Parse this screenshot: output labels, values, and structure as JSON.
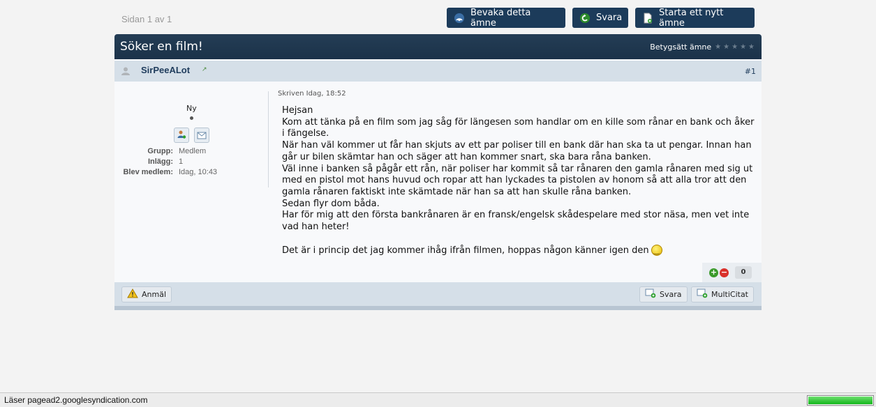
{
  "pager": {
    "text": "Sidan 1 av 1"
  },
  "top_buttons": {
    "watch": "Bevaka detta ämne",
    "reply": "Svara",
    "new_topic": "Starta ett nytt ämne"
  },
  "topic": {
    "title": "Söker en film!",
    "rate_label": "Betygsätt ämne",
    "stars": [
      "★",
      "★",
      "★",
      "★",
      "★"
    ]
  },
  "post": {
    "author": "SirPeeALot",
    "number": "#1",
    "rank": "Ny",
    "info": {
      "group_label": "Grupp:",
      "group_value": "Medlem",
      "posts_label": "Inlägg:",
      "posts_value": "1",
      "joined_label": "Blev medlem:",
      "joined_value": "Idag, 10:43"
    },
    "posted": "Skriven Idag, 18:52",
    "body_lines": [
      "Hejsan",
      "Kom att tänka på en film som jag såg för längesen som handlar om en kille som rånar en bank och åker i fängelse.",
      "När han väl kommer ut får han skjuts av ett par poliser till en bank där han ska ta ut pengar. Innan han går ur bilen skämtar han och säger att han kommer snart, ska bara råna banken.",
      "Väl inne i banken så pågår ett rån, när poliser har kommit så tar rånaren den gamla rånaren med sig ut med en pistol mot hans huvud och ropar att han lyckades ta pistolen av honom så att alla tror att den gamla rånaren faktiskt inte skämtade när han sa att han skulle råna banken.",
      "Sedan flyr dom båda.",
      "Har för mig att den första bankrånaren är en fransk/engelsk skådespelare med stor näsa, men vet inte vad han heter!",
      "",
      "Det är i princip det jag kommer ihåg ifrån filmen, hoppas någon känner igen den"
    ],
    "reputation": "0",
    "report": "Anmäl",
    "reply": "Svara",
    "multiquote": "MultiCitat"
  },
  "statusbar": {
    "text": "Läser pagead2.googlesyndication.com",
    "progress_fraction": 1.0
  },
  "colors": {
    "header_bg": "#1c3b5a",
    "author_bar": "#d5dfe8",
    "page_bg": "#f3f3f3"
  }
}
